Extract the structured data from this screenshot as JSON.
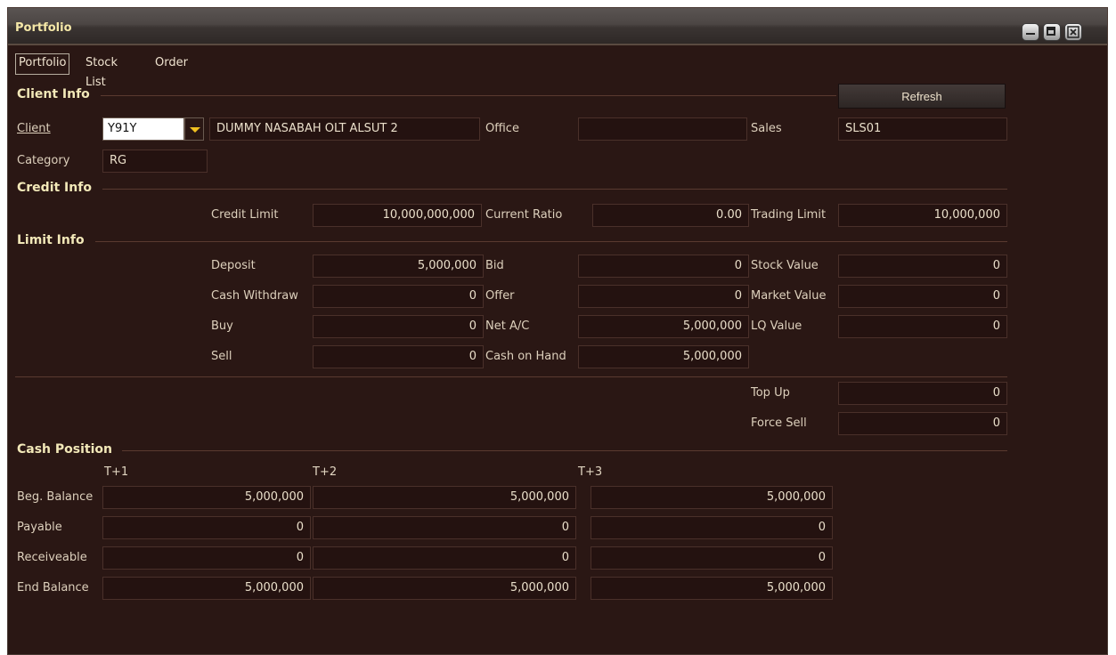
{
  "window": {
    "title": "Portfolio",
    "buttons": [
      "minimize-icon",
      "maximize-icon",
      "close-icon"
    ]
  },
  "tabs": [
    {
      "label": "Portfolio",
      "active": true
    },
    {
      "label": "Stock List",
      "active": false
    },
    {
      "label": "Order",
      "active": false
    }
  ],
  "client_info": {
    "heading": "Client Info",
    "refresh_label": "Refresh",
    "client_label": "Client",
    "client_code": "Y91Y",
    "client_name": "DUMMY NASABAH OLT ALSUT 2",
    "office_label": "Office",
    "office_value": "",
    "sales_label": "Sales",
    "sales_value": "SLS01",
    "category_label": "Category",
    "category_value": "RG"
  },
  "credit_info": {
    "heading": "Credit Info",
    "credit_limit_label": "Credit Limit",
    "credit_limit": "10,000,000,000",
    "current_ratio_label": "Current Ratio",
    "current_ratio": "0.00",
    "trading_limit_label": "Trading Limit",
    "trading_limit": "10,000,000"
  },
  "limit_info": {
    "heading": "Limit Info",
    "deposit_label": "Deposit",
    "deposit": "5,000,000",
    "bid_label": "Bid",
    "bid": "0",
    "stock_value_label": "Stock Value",
    "stock_value": "0",
    "cash_withdraw_label": "Cash Withdraw",
    "cash_withdraw": "0",
    "offer_label": "Offer",
    "offer": "0",
    "market_value_label": "Market Value",
    "market_value": "0",
    "buy_label": "Buy",
    "buy": "0",
    "net_ac_label": "Net A/C",
    "net_ac": "5,000,000",
    "lq_value_label": "LQ Value",
    "lq_value": "0",
    "sell_label": "Sell",
    "sell": "0",
    "cash_on_hand_label": "Cash on Hand",
    "cash_on_hand": "5,000,000",
    "top_up_label": "Top Up",
    "top_up": "0",
    "force_sell_label": "Force Sell",
    "force_sell": "0"
  },
  "cash_position": {
    "heading": "Cash Position",
    "columns": [
      "T+1",
      "T+2",
      "T+3"
    ],
    "rows": [
      {
        "label": "Beg. Balance",
        "values": [
          "5,000,000",
          "5,000,000",
          "5,000,000"
        ]
      },
      {
        "label": "Payable",
        "values": [
          "0",
          "0",
          "0"
        ]
      },
      {
        "label": "Receiveable",
        "values": [
          "0",
          "0",
          "0"
        ]
      },
      {
        "label": "End Balance",
        "values": [
          "5,000,000",
          "5,000,000",
          "5,000,000"
        ]
      }
    ]
  },
  "colors": {
    "background": "#2a1714",
    "heading": "#f2e8b8",
    "accent_arrow": "#f0c020"
  }
}
